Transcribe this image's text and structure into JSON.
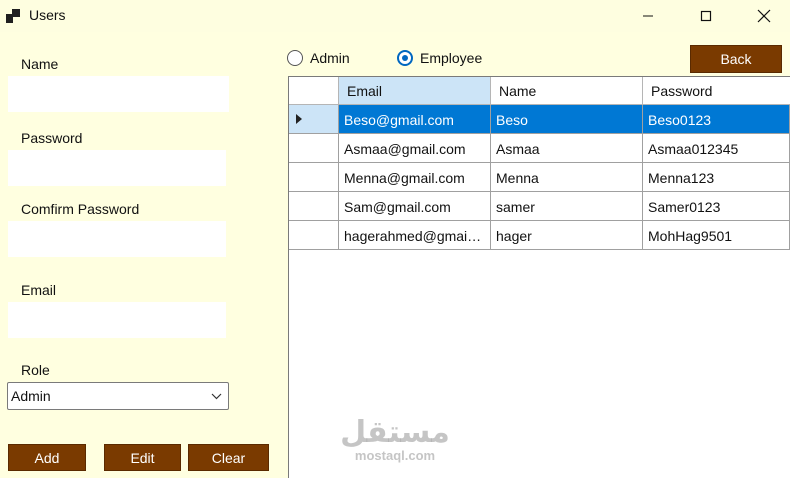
{
  "window": {
    "title": "Users"
  },
  "form": {
    "name_label": "Name",
    "name_value": "",
    "password_label": "Password",
    "password_value": "",
    "confirm_label": "Comfirm Password",
    "confirm_value": "",
    "email_label": "Email",
    "email_value": "",
    "role_label": "Role",
    "role_value": "Admin"
  },
  "buttons": {
    "add": "Add",
    "edit": "Edit",
    "clear": "Clear",
    "back": "Back"
  },
  "filter": {
    "admin": "Admin",
    "employee": "Employee",
    "selected": "Employee"
  },
  "grid": {
    "columns": [
      "Email",
      "Name",
      "Password"
    ],
    "sorted_column": "Email",
    "selected_row": 0,
    "rows": [
      [
        "Beso@gmail.com",
        "Beso",
        "Beso0123"
      ],
      [
        "Asmaa@gmail.com",
        "Asmaa",
        "Asmaa012345"
      ],
      [
        "Menna@gmail.com",
        "Menna",
        "Menna123"
      ],
      [
        "Sam@gmail.com",
        "samer",
        "Samer0123"
      ],
      [
        "hagerahmed@gmai…",
        "hager",
        "MohHag9501"
      ]
    ]
  },
  "watermark": {
    "arabic": "مستقل",
    "latin": "mostaql.com"
  },
  "colors": {
    "window_bg": "#ffffe0",
    "button_bg": "#7a3a00",
    "selection": "#0078d4",
    "header_highlight": "#cce4f7",
    "radio_accent": "#0067c0"
  }
}
